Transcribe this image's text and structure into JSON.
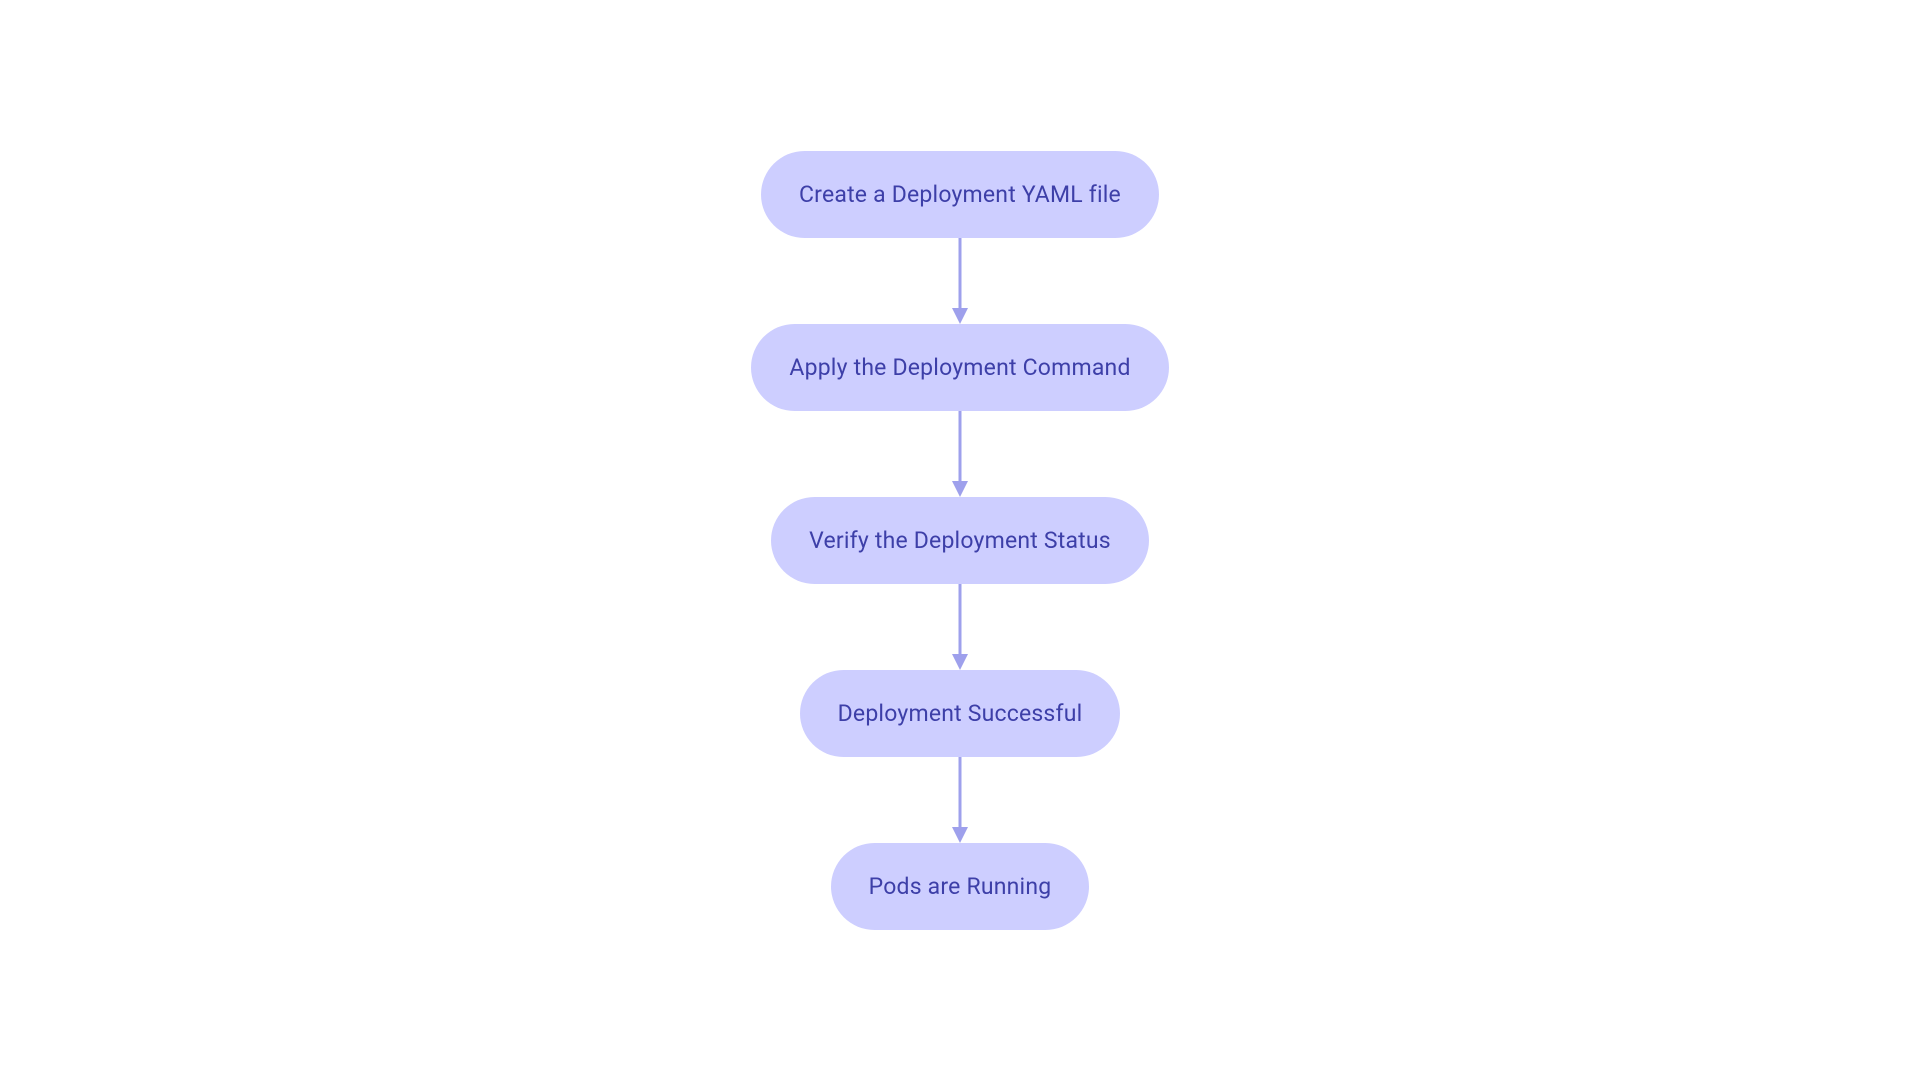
{
  "chart_data": {
    "type": "flowchart",
    "direction": "top-to-bottom",
    "nodes": [
      {
        "id": "n1",
        "label": "Create a Deployment YAML file"
      },
      {
        "id": "n2",
        "label": "Apply the Deployment Command"
      },
      {
        "id": "n3",
        "label": "Verify the Deployment Status"
      },
      {
        "id": "n4",
        "label": "Deployment Successful"
      },
      {
        "id": "n5",
        "label": "Pods are Running"
      }
    ],
    "edges": [
      {
        "from": "n1",
        "to": "n2"
      },
      {
        "from": "n2",
        "to": "n3"
      },
      {
        "from": "n3",
        "to": "n4"
      },
      {
        "from": "n4",
        "to": "n5"
      }
    ],
    "style": {
      "node_fill": "#cdceff",
      "node_text": "#3d3fa8",
      "arrow_color": "#9ea0ec"
    }
  }
}
